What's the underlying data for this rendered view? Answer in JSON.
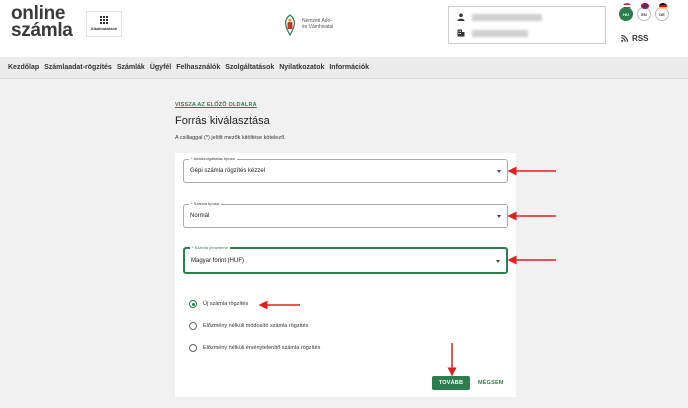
{
  "header": {
    "logo_line1_a": "online",
    "logo_line2": "számla",
    "apps_label": "Alkalmazások",
    "authority_line1": "Nemzeti Adó-",
    "authority_line2": "és Vámhivatal",
    "languages": [
      {
        "code": "HU",
        "active": true
      },
      {
        "code": "EN",
        "active": false
      },
      {
        "code": "DE",
        "active": false
      }
    ],
    "rss_label": "RSS"
  },
  "menu": {
    "items": [
      "Kezdőlap",
      "Számlaadat-rögzítés",
      "Számlák",
      "Ügyfél",
      "Felhasználók",
      "Szolgáltatások",
      "Nyilatkozatok",
      "Információk"
    ]
  },
  "main": {
    "back_link": "VISSZA AZ ELŐZŐ OLDALRA",
    "title": "Forrás kiválasztása",
    "required_note": "A csillaggal (*) jelölt mezők kitöltése kötelező.",
    "fields": [
      {
        "label": "* Adatszolgáltatás típusa",
        "value": "Gépi számla rögzítés kézzel"
      },
      {
        "label": "* Számla típusa",
        "value": "Normál"
      },
      {
        "label": "* Számla pénzneme",
        "value": "Magyar forint (HUF)"
      }
    ],
    "radios": [
      {
        "label": "Új számla rögzítés",
        "selected": true
      },
      {
        "label": "Előzmény nélküli módosító számla rögzítés",
        "selected": false
      },
      {
        "label": "Előzmény nélküli érvénytelenítő számla rögzítés",
        "selected": false
      }
    ],
    "next_button": "TOVÁBB",
    "cancel_button": "MÉGSEM"
  },
  "colors": {
    "accent": "#2e7d4f",
    "annotation_arrow": "#e02020"
  }
}
